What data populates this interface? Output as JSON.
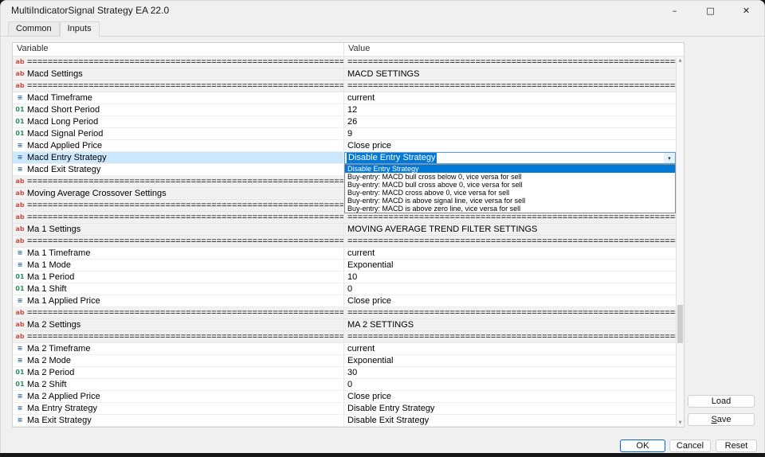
{
  "window": {
    "title": "MultiIndicatorSignal Strategy EA 22.0",
    "controls": {
      "minimize": "–",
      "maximize": "□",
      "close": "✕"
    }
  },
  "tabs": [
    {
      "label": "Common"
    },
    {
      "label": "Inputs"
    }
  ],
  "active_tab": "Inputs",
  "table": {
    "columns": {
      "variable": "Variable",
      "value": "Value"
    },
    "icons": {
      "string": {
        "glyph": "ab",
        "color": "#c05046"
      },
      "integer": {
        "glyph": "01",
        "color": "#2e8b57"
      },
      "enum": {
        "glyph": "≡",
        "color": "#3b6ea5"
      }
    },
    "rows": [
      {
        "type": "string",
        "variable": "======================================================================",
        "value": "======================================================================"
      },
      {
        "type": "string",
        "variable": "Macd Settings",
        "value": "MACD SETTINGS"
      },
      {
        "type": "string",
        "variable": "======================================================================",
        "value": "======================================================================"
      },
      {
        "type": "enum",
        "variable": "Macd Timeframe",
        "value": "current"
      },
      {
        "type": "integer",
        "variable": "Macd Short Period",
        "value": "12"
      },
      {
        "type": "integer",
        "variable": "Macd Long Period",
        "value": "26"
      },
      {
        "type": "integer",
        "variable": "Macd Signal Period",
        "value": "9"
      },
      {
        "type": "enum",
        "variable": "Macd Applied Price",
        "value": "Close price"
      },
      {
        "type": "enum",
        "variable": "Macd Entry Strategy",
        "value": "",
        "selected": true
      },
      {
        "type": "enum",
        "variable": "Macd Exit Strategy",
        "value": ""
      },
      {
        "type": "string",
        "variable": "======================================================================",
        "value": ""
      },
      {
        "type": "string",
        "variable": "Moving Average Crossover Settings",
        "value": ""
      },
      {
        "type": "string",
        "variable": "======================================================================",
        "value": ""
      },
      {
        "type": "string",
        "variable": "======================================================================",
        "value": "======================================================================"
      },
      {
        "type": "string",
        "variable": "Ma 1 Settings",
        "value": "MOVING AVERAGE TREND FILTER SETTINGS"
      },
      {
        "type": "string",
        "variable": "======================================================================",
        "value": "======================================================================"
      },
      {
        "type": "enum",
        "variable": "Ma 1 Timeframe",
        "value": "current"
      },
      {
        "type": "enum",
        "variable": "Ma 1 Mode",
        "value": "Exponential"
      },
      {
        "type": "integer",
        "variable": "Ma 1 Period",
        "value": "10"
      },
      {
        "type": "integer",
        "variable": "Ma 1 Shift",
        "value": "0"
      },
      {
        "type": "enum",
        "variable": "Ma 1 Applied Price",
        "value": "Close price"
      },
      {
        "type": "string",
        "variable": "======================================================================",
        "value": "======================================================================"
      },
      {
        "type": "string",
        "variable": "Ma 2 Settings",
        "value": "MA 2 SETTINGS"
      },
      {
        "type": "string",
        "variable": "======================================================================",
        "value": "======================================================================"
      },
      {
        "type": "enum",
        "variable": "Ma 2 Timeframe",
        "value": "current"
      },
      {
        "type": "enum",
        "variable": "Ma 2 Mode",
        "value": "Exponential"
      },
      {
        "type": "integer",
        "variable": "Ma 2 Period",
        "value": "30"
      },
      {
        "type": "integer",
        "variable": "Ma 2 Shift",
        "value": "0"
      },
      {
        "type": "enum",
        "variable": "Ma 2 Applied Price",
        "value": "Close price"
      },
      {
        "type": "enum",
        "variable": "Ma Entry Strategy",
        "value": "Disable Entry Strategy"
      },
      {
        "type": "enum",
        "variable": "Ma Exit Strategy",
        "value": "Disable Exit Strategy"
      }
    ]
  },
  "dropdown": {
    "field": "Macd Entry Strategy",
    "selected": "Disable Entry Strategy",
    "selected_index": 0,
    "chevron": "▾",
    "options": [
      "Disable Entry Strategy",
      "Buy-entry: MACD bull cross below 0, vice versa for sell",
      "Buy-entry: MACD bull cross above 0, vice versa for sell",
      "Buy-entry: MACD cross above 0, vice versa for sell",
      "Buy-entry: MACD is above signal line, vice versa for sell",
      "Buy-entry: MACD is above zero line, vice versa for sell"
    ]
  },
  "buttons": {
    "load": "Load",
    "save": "Save",
    "ok": "OK",
    "cancel": "Cancel",
    "reset": "Reset"
  },
  "scrollbar": {
    "up_arrow": "▲",
    "down_arrow": "▼"
  },
  "colors": {
    "accent": "#0078d7",
    "selection_row": "#cce8ff"
  }
}
